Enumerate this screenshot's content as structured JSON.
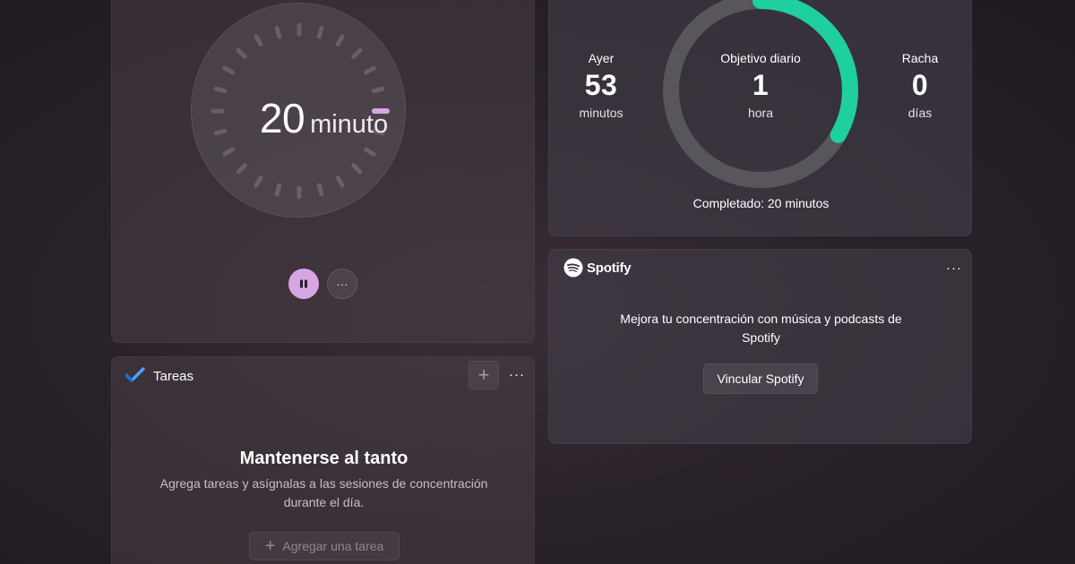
{
  "timer": {
    "value": "20",
    "unit": "minuto",
    "accent_color": "#d7a6e2",
    "pause_icon": "pause-icon",
    "more_label": "···"
  },
  "tasks": {
    "title": "Tareas",
    "logo_icon": "checkmark-icon",
    "add_icon": "+",
    "more_label": "···",
    "heading": "Mantenerse al tanto",
    "description": "Agrega tareas y asígnalas a las sesiones de concentración durante el día.",
    "add_task_icon": "+",
    "add_task_label": "Agregar una tarea"
  },
  "progress": {
    "yesterday_label": "Ayer",
    "yesterday_value": "53",
    "yesterday_unit": "minutos",
    "goal_label": "Objetivo diario",
    "goal_value": "1",
    "goal_unit": "hora",
    "streak_label": "Racha",
    "streak_value": "0",
    "streak_unit": "días",
    "completed_text": "Completado: 20 minutos",
    "goal_fraction": 0.333,
    "ring_color": "#1ecfa0",
    "ring_track_color": "#58555b"
  },
  "spotify": {
    "brand": "Spotify",
    "logo_icon": "spotify-icon",
    "more_label": "···",
    "description": "Mejora tu concentración con música y podcasts de Spotify",
    "link_button_label": "Vincular Spotify"
  }
}
